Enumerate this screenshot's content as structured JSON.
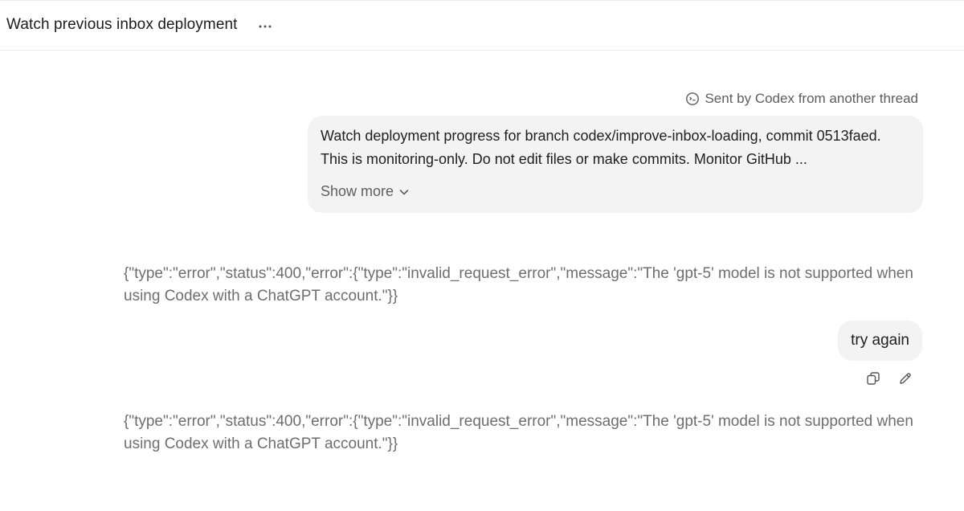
{
  "header": {
    "title": "Watch previous inbox deployment",
    "more_icon": "ellipsis-icon"
  },
  "conversation": {
    "origin_note": {
      "icon": "codex-face-icon",
      "text": "Sent by Codex from another thread"
    },
    "first_user_message": {
      "text": "Watch deployment progress for branch codex/improve-inbox-loading, commit 0513faed. This is monitoring-only. Do not edit files or make commits. Monitor GitHub ...",
      "show_more_label": "Show more",
      "show_more_icon": "chevron-down-icon"
    },
    "error_1": {
      "text": "{\"type\":\"error\",\"status\":400,\"error\":{\"type\":\"invalid_request_error\",\"message\":\"The 'gpt-5' model is not supported when using Codex with a ChatGPT account.\"}}"
    },
    "second_user_message": {
      "text": "try again",
      "actions": [
        "copy-icon",
        "edit-pencil-icon"
      ]
    },
    "error_2": {
      "text": "{\"type\":\"error\",\"status\":400,\"error\":{\"type\":\"invalid_request_error\",\"message\":\"The 'gpt-5' model is not supported when using Codex with a ChatGPT account.\"}}"
    }
  }
}
